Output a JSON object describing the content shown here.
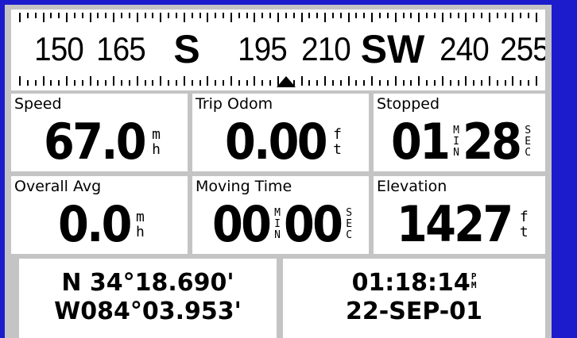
{
  "compass": {
    "headings": [
      "150",
      "165",
      "S",
      "195",
      "210",
      "SW",
      "240",
      "255"
    ]
  },
  "fields": {
    "speed": {
      "label": "Speed",
      "value": "67.0",
      "unit": [
        "m",
        "h"
      ]
    },
    "trip_odom": {
      "label": "Trip Odom",
      "value": "0.00",
      "unit": [
        "f",
        "t"
      ]
    },
    "stopped": {
      "label": "Stopped",
      "min": "01",
      "min_unit": [
        "M",
        "I",
        "N"
      ],
      "sec": "28",
      "sec_unit": [
        "S",
        "E",
        "C"
      ]
    },
    "overall_avg": {
      "label": "Overall Avg",
      "value": "0.0",
      "unit": [
        "m",
        "h"
      ]
    },
    "moving_time": {
      "label": "Moving Time",
      "min": "00",
      "min_unit": [
        "M",
        "I",
        "N"
      ],
      "sec": "00",
      "sec_unit": [
        "S",
        "E",
        "C"
      ]
    },
    "elevation": {
      "label": "Elevation",
      "value": "1427",
      "unit": [
        "f",
        "t"
      ]
    }
  },
  "position": {
    "lat": "N  34°18.690'",
    "lon": "W084°03.953'"
  },
  "clock": {
    "time": "01:18:14",
    "ampm": [
      "P",
      "M"
    ],
    "date": "22-SEP-01"
  }
}
